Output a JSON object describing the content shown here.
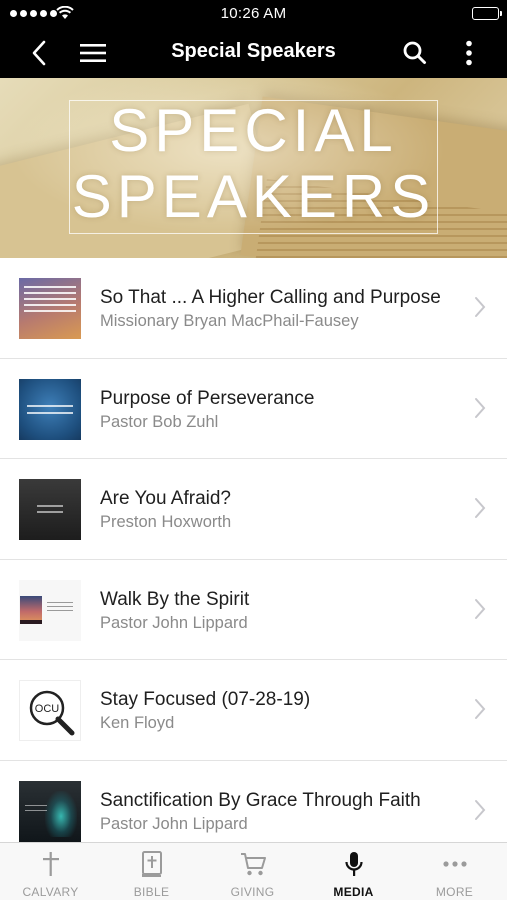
{
  "status_bar": {
    "time": "10:26 AM"
  },
  "nav": {
    "title": "Special Speakers"
  },
  "banner": {
    "title_line1": "SPECIAL",
    "title_line2": "SPEAKERS"
  },
  "items": [
    {
      "title": "So That ... A Higher Calling and Purpose",
      "subtitle": "Missionary Bryan MacPhail-Fausey",
      "thumb_text": "1 Peter 3:8 So That ... A Higher Calling and Purpose"
    },
    {
      "title": "Purpose of Perseverance",
      "subtitle": "Pastor Bob Zuhl",
      "thumb_text": "THE PURPOSE OF PERSEVERANCE"
    },
    {
      "title": "Are You Afraid?",
      "subtitle": "Preston Hoxworth",
      "thumb_text": "ARE YOU AFRAID?"
    },
    {
      "title": "Walk By the Spirit",
      "subtitle": "Pastor John Lippard"
    },
    {
      "title": "Stay Focused (07-28-19)",
      "subtitle": "Ken Floyd",
      "thumb_text": "FOCUS"
    },
    {
      "title": "Sanctification By Grace Through Faith",
      "subtitle": "Pastor John Lippard"
    }
  ],
  "tabs": [
    {
      "label": "CALVARY",
      "icon": "cross-icon",
      "active": false
    },
    {
      "label": "BIBLE",
      "icon": "bible-icon",
      "active": false
    },
    {
      "label": "GIVING",
      "icon": "cart-icon",
      "active": false
    },
    {
      "label": "MEDIA",
      "icon": "microphone-icon",
      "active": true
    },
    {
      "label": "MORE",
      "icon": "ellipsis-icon",
      "active": false
    }
  ],
  "colors": {
    "nav_background": "#000000",
    "tab_active": "#111111",
    "tab_inactive": "#9b9b9b",
    "subtitle": "#8a8a8a"
  }
}
